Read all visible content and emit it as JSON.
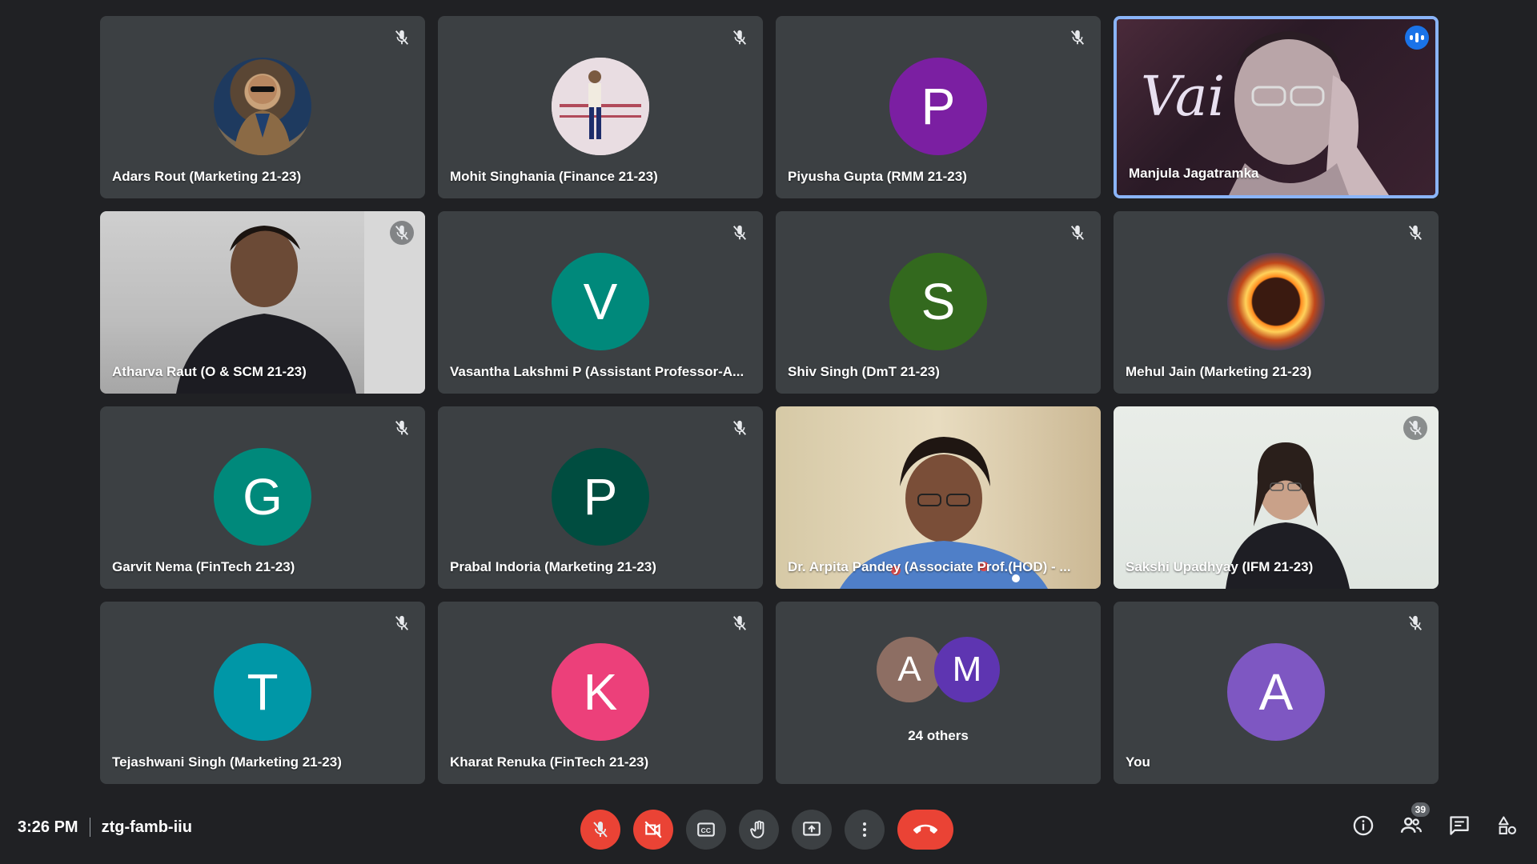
{
  "tiles": [
    {
      "name": "Adars Rout (Marketing 21-23)"
    },
    {
      "name": "Mohit Singhania (Finance 21-23)"
    },
    {
      "name": "Piyusha Gupta (RMM 21-23)",
      "initial": "P"
    },
    {
      "name": "Manjula Jagatramka"
    },
    {
      "name": "Atharva Raut (O & SCM 21-23)"
    },
    {
      "name": "Vasantha Lakshmi P (Assistant Professor-A...",
      "initial": "V"
    },
    {
      "name": "Shiv Singh (DmT 21-23)",
      "initial": "S"
    },
    {
      "name": "Mehul Jain (Marketing 21-23)"
    },
    {
      "name": "Garvit Nema (FinTech 21-23)",
      "initial": "G"
    },
    {
      "name": "Prabal Indoria (Marketing 21-23)",
      "initial": "P"
    },
    {
      "name": "Dr. Arpita Pandey (Associate Prof.(HOD) - ..."
    },
    {
      "name": "Sakshi Upadhyay (IFM 21-23)"
    },
    {
      "name": "Tejashwani Singh (Marketing 21-23)",
      "initial": "T"
    },
    {
      "name": "Kharat Renuka (FinTech 21-23)",
      "initial": "K"
    },
    {
      "others_label": "24 others",
      "initials": [
        "A",
        "M"
      ]
    },
    {
      "name": "You",
      "initial": "A"
    }
  ],
  "whiteboard_text": "Vai",
  "footer": {
    "time": "3:26 PM",
    "meeting_code": "ztg-famb-iiu",
    "people_count": "39"
  },
  "colors": {
    "background": "#202124",
    "tile": "#3c4043",
    "active_border": "#8ab4f8",
    "danger": "#ea4335",
    "avatar_purple_1": "#7b1fa2",
    "avatar_teal_v": "#00897b",
    "avatar_green_s": "#33691e",
    "avatar_teal_g": "#00897b",
    "avatar_darkgreen_p": "#004d40",
    "avatar_cyan_t": "#0097a7",
    "avatar_pink_k": "#ec407a",
    "avatar_brown_a": "#8d6e63",
    "avatar_purple_m": "#5e35b1",
    "avatar_purple_you": "#7e57c2"
  },
  "icons": {
    "muted": "mic-off-icon",
    "speaking": "audio-level-icon",
    "mic": "mic-off-icon",
    "camera": "camera-off-icon",
    "captions": "captions-icon",
    "hand": "raise-hand-icon",
    "present": "present-icon",
    "more": "more-vert-icon",
    "end": "end-call-icon",
    "info": "info-icon",
    "people": "people-icon",
    "chat": "chat-icon",
    "activities": "activities-icon"
  }
}
